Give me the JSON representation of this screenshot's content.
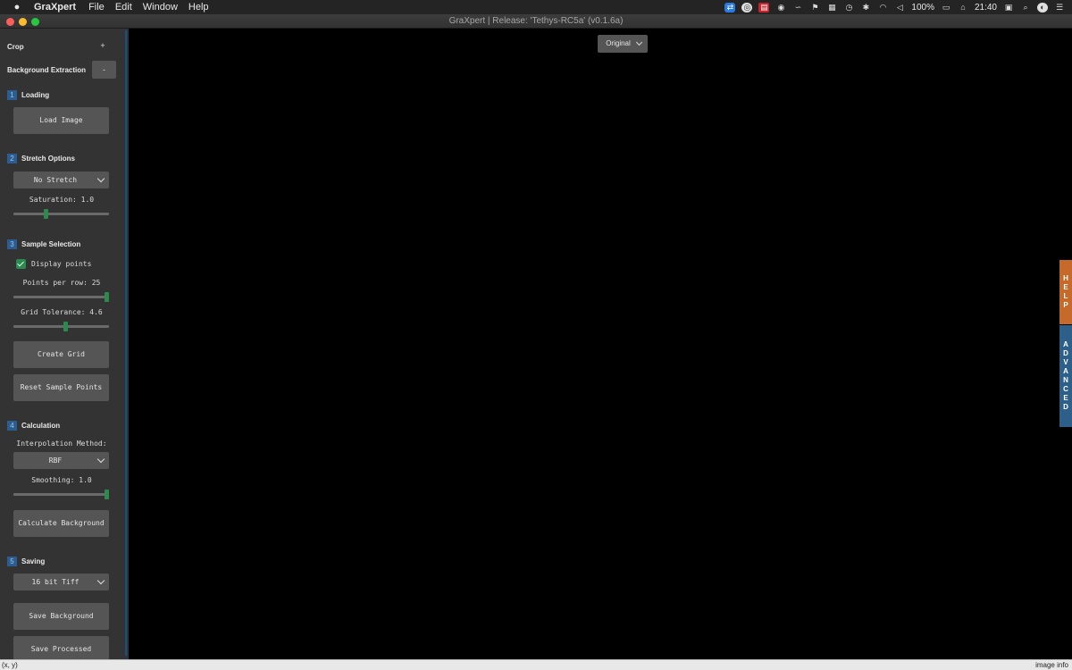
{
  "menubar": {
    "app_name": "GraXpert",
    "items": [
      "File",
      "Edit",
      "Window",
      "Help"
    ],
    "battery": "100%",
    "clock": "21:40"
  },
  "window": {
    "title": "GraXpert | Release: 'Tethys-RC5a' (v0.1.6a)"
  },
  "sidebar": {
    "crop": {
      "label": "Crop",
      "toggle": "+"
    },
    "background_extraction": {
      "label": "Background Extraction",
      "toggle": "-"
    },
    "loading": {
      "step": "1",
      "label": "Loading",
      "load_button": "Load Image"
    },
    "stretch": {
      "step": "2",
      "label": "Stretch Options",
      "selected": "No Stretch",
      "saturation_label": "Saturation: 1.0",
      "saturation_level": 0.33
    },
    "sample_selection": {
      "step": "3",
      "label": "Sample Selection",
      "display_points_label": "Display points",
      "display_points_checked": true,
      "points_per_row_label": "Points per row: 25",
      "points_per_row_level": 1.0,
      "grid_tolerance_label": "Grid Tolerance: 4.6",
      "grid_tolerance_level": 0.55,
      "create_grid_button": "Create Grid",
      "reset_button": "Reset Sample Points"
    },
    "calculation": {
      "step": "4",
      "label": "Calculation",
      "interpolation_label": "Interpolation Method:",
      "interpolation_selected": "RBF",
      "smoothing_label": "Smoothing: 1.0",
      "smoothing_level": 1.0,
      "calculate_button": "Calculate Background"
    },
    "saving": {
      "step": "5",
      "label": "Saving",
      "format_selected": "16 bit Tiff",
      "save_background_button": "Save Background",
      "save_processed_button": "Save Processed"
    }
  },
  "canvas": {
    "view_selected": "Original"
  },
  "side_tabs": {
    "help": "HELP",
    "advanced": "ADVANCED"
  },
  "statusbar": {
    "coords": "(x, y)",
    "image_info": "image info"
  },
  "colors": {
    "accent_green": "#2d8a4e",
    "step_blue": "#2c5d91",
    "help_orange": "#c56a2a",
    "advanced_blue": "#2d5f88"
  }
}
